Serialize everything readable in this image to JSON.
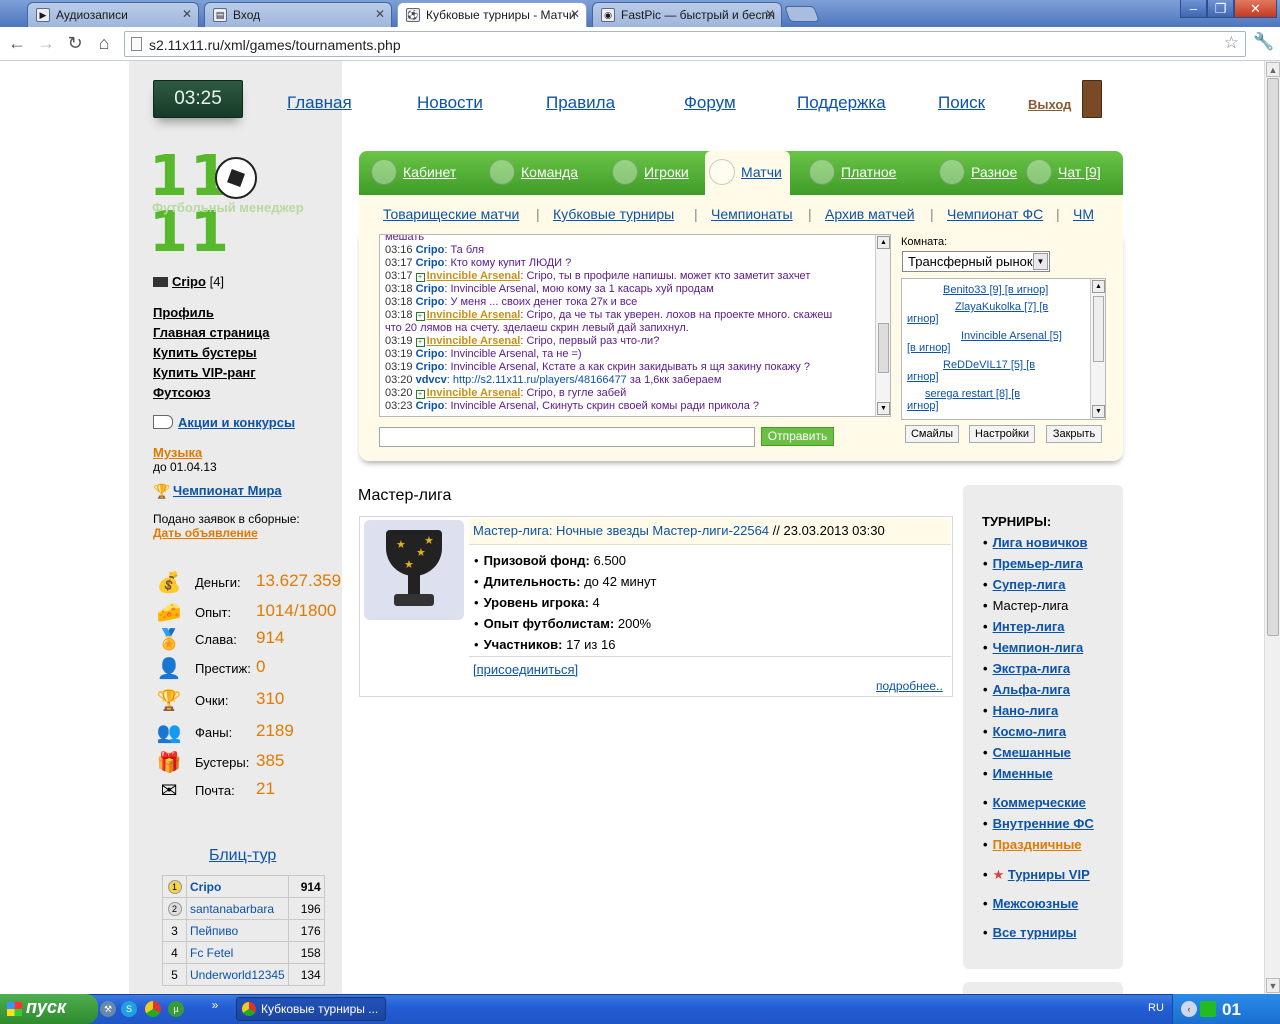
{
  "browser": {
    "tabs": [
      {
        "title": "Аудиозаписи",
        "active": false
      },
      {
        "title": "Вход",
        "active": false
      },
      {
        "title": "Кубковые турниры - Матчи",
        "active": true
      },
      {
        "title": "FastPic — быстрый и беспл",
        "active": false
      }
    ],
    "url": "s2.11x11.ru/xml/games/tournaments.php"
  },
  "header": {
    "clock": "03:25",
    "nav": [
      "Главная",
      "Новости",
      "Правила",
      "Форум",
      "Поддержка",
      "Поиск"
    ],
    "exit": "Выход",
    "logo_number": "11 11",
    "logo_sub": "Футбольный менеджер"
  },
  "menu": {
    "items": [
      "Кабинет",
      "Команда",
      "Игроки",
      "Матчи",
      "Платное",
      "Разное",
      "Чат [9]"
    ],
    "active": "Матчи",
    "sub": [
      "Товарищеские матчи",
      "Кубковые турниры",
      "Чемпионаты",
      "Архив матчей",
      "Чемпионат ФС",
      "ЧМ"
    ]
  },
  "chat": {
    "messages": [
      {
        "time": "",
        "user": "",
        "text": "мешать",
        "star": false
      },
      {
        "time": "03:16",
        "user": "Cripo",
        "text": ": Та бля",
        "star": false
      },
      {
        "time": "03:17",
        "user": "Cripo",
        "text": ": Кто кому купит ЛЮДИ ?",
        "star": false
      },
      {
        "time": "03:17",
        "user": "Invincible Arsenal",
        "text": ": Cripo, ты в профиле напишы. может кто заметит захчет",
        "star": true
      },
      {
        "time": "03:18",
        "user": "Cripo",
        "text": ": Invincible Arsenal, мою кому за 1 касарь хуй продам",
        "star": false
      },
      {
        "time": "03:18",
        "user": "Cripo",
        "text": ": У меня ... своих денег тока 27к и все",
        "star": false
      },
      {
        "time": "03:18",
        "user": "Invincible Arsenal",
        "text": ": Cripo, да че ты так уверен. лохов на проекте много. скажеш",
        "star": true
      },
      {
        "time": "",
        "user": "",
        "text": "что 20 лямов на счету. зделаеш скрин левый дай запихнул.",
        "star": false
      },
      {
        "time": "03:19",
        "user": "Invincible Arsenal",
        "text": ": Cripo, первый раз что-ли?",
        "star": true
      },
      {
        "time": "03:19",
        "user": "Cripo",
        "text": ": Invincible Arsenal, та не =)",
        "star": false
      },
      {
        "time": "03:19",
        "user": "Cripo",
        "text": ": Invincible Arsenal, Кстате а как скрин закидывать я щя закину покажу ?",
        "star": false
      },
      {
        "time": "03:20",
        "user": "vdvcv",
        "text": " за 1,6кк забераем",
        "link": "http://s2.11x11.ru/players/48166477",
        "star": false
      },
      {
        "time": "03:20",
        "user": "Invincible Arsenal",
        "text": ": Cripo, в гугле забей",
        "star": true
      },
      {
        "time": "03:23",
        "user": "Cripo",
        "text": ": Invincible Arsenal, Скинуть скрин своей комы ради прикола ?",
        "star": false
      }
    ],
    "send_label": "Отправить",
    "room_label": "Комната:",
    "room_value": "Трансферный рынок",
    "users": [
      "Benito33 [9]  [в игнор]",
      "ZlayaKukolka [7]  [в",
      "игнор]",
      "Invincible Arsenal [5]",
      "[в игнор]",
      "ReDDeVIL17 [5]  [в",
      "игнор]",
      "serega restart [8]  [в",
      "игнор]"
    ],
    "buttons": [
      "Смайлы",
      "Настройки",
      "Закрыть"
    ]
  },
  "sidebar": {
    "user": "Cripo",
    "level": "[4]",
    "links": [
      "Профиль",
      "Главная страница",
      "Купить бустеры",
      "Купить VIP-ранг",
      "Футсоюз"
    ],
    "promo": "Акции и конкурсы",
    "music": "Музыка",
    "music_date": "до 01.04.13",
    "wc": "Чемпионат Мира",
    "apply_text": "Подано заявок в сборные:",
    "apply_link": "Дать объявление",
    "stats": [
      {
        "label": "Деньги:",
        "value": "13.627.359",
        "icon": "money-bag-icon"
      },
      {
        "label": "Опыт:",
        "value": "1014/1800",
        "icon": "experience-icon"
      },
      {
        "label": "Слава:",
        "value": "914",
        "icon": "podium-icon"
      },
      {
        "label": "Престиж:",
        "value": "0",
        "icon": "prestige-icon"
      },
      {
        "label": "Очки:",
        "value": "310",
        "icon": "trophy-icon"
      },
      {
        "label": "Фаны:",
        "value": "2189",
        "icon": "fans-icon"
      },
      {
        "label": "Бустеры:",
        "value": "385",
        "icon": "booster-icon"
      },
      {
        "label": "Почта:",
        "value": "21",
        "icon": "mail-icon"
      }
    ],
    "blitz_title": "Блиц-тур",
    "blitz": [
      {
        "rank": "1",
        "name": "Cripo",
        "points": "914"
      },
      {
        "rank": "2",
        "name": "santanabarbara",
        "points": "196"
      },
      {
        "rank": "3",
        "name": "Пейпиво",
        "points": "176"
      },
      {
        "rank": "4",
        "name": "Fc Fetel",
        "points": "158"
      },
      {
        "rank": "5",
        "name": "Underworld12345",
        "points": "134"
      }
    ]
  },
  "main": {
    "section_title": "Мастер-лига",
    "tournament": {
      "title": "Мастер-лига: Ночные звезды Мастер-лиги-22564",
      "date": " // 23.03.2013 03:30",
      "props": [
        {
          "k": "Призовой фонд:",
          "v": " 6.500"
        },
        {
          "k": "Длительность:",
          "v": " до 42 минут"
        },
        {
          "k": "Уровень игрока:",
          "v": " 4"
        },
        {
          "k": "Опыт футболистам:",
          "v": " 200%"
        },
        {
          "k": "Участников:",
          "v": " 17 из 16"
        }
      ],
      "join": "[присоединиться]",
      "more": "подробнее.."
    },
    "tournaments_head": "ТУРНИРЫ:",
    "tournaments": [
      "Лига новичков",
      "Премьер-лига",
      "Супер-лига",
      "Мастер-лига",
      "Интер-лига",
      "Чемпион-лига",
      "Экстра-лига",
      "Альфа-лига",
      "Нано-лига",
      "Космо-лига",
      "Смешанные",
      "Именные",
      "Коммерческие",
      "Внутренние ФС",
      "Праздничные",
      "Турниры VIP",
      "Межсоюзные",
      "Все турниры"
    ]
  },
  "taskbar": {
    "start": "пуск",
    "task": "Кубковые турниры ...",
    "lang": "RU",
    "time": "01"
  }
}
